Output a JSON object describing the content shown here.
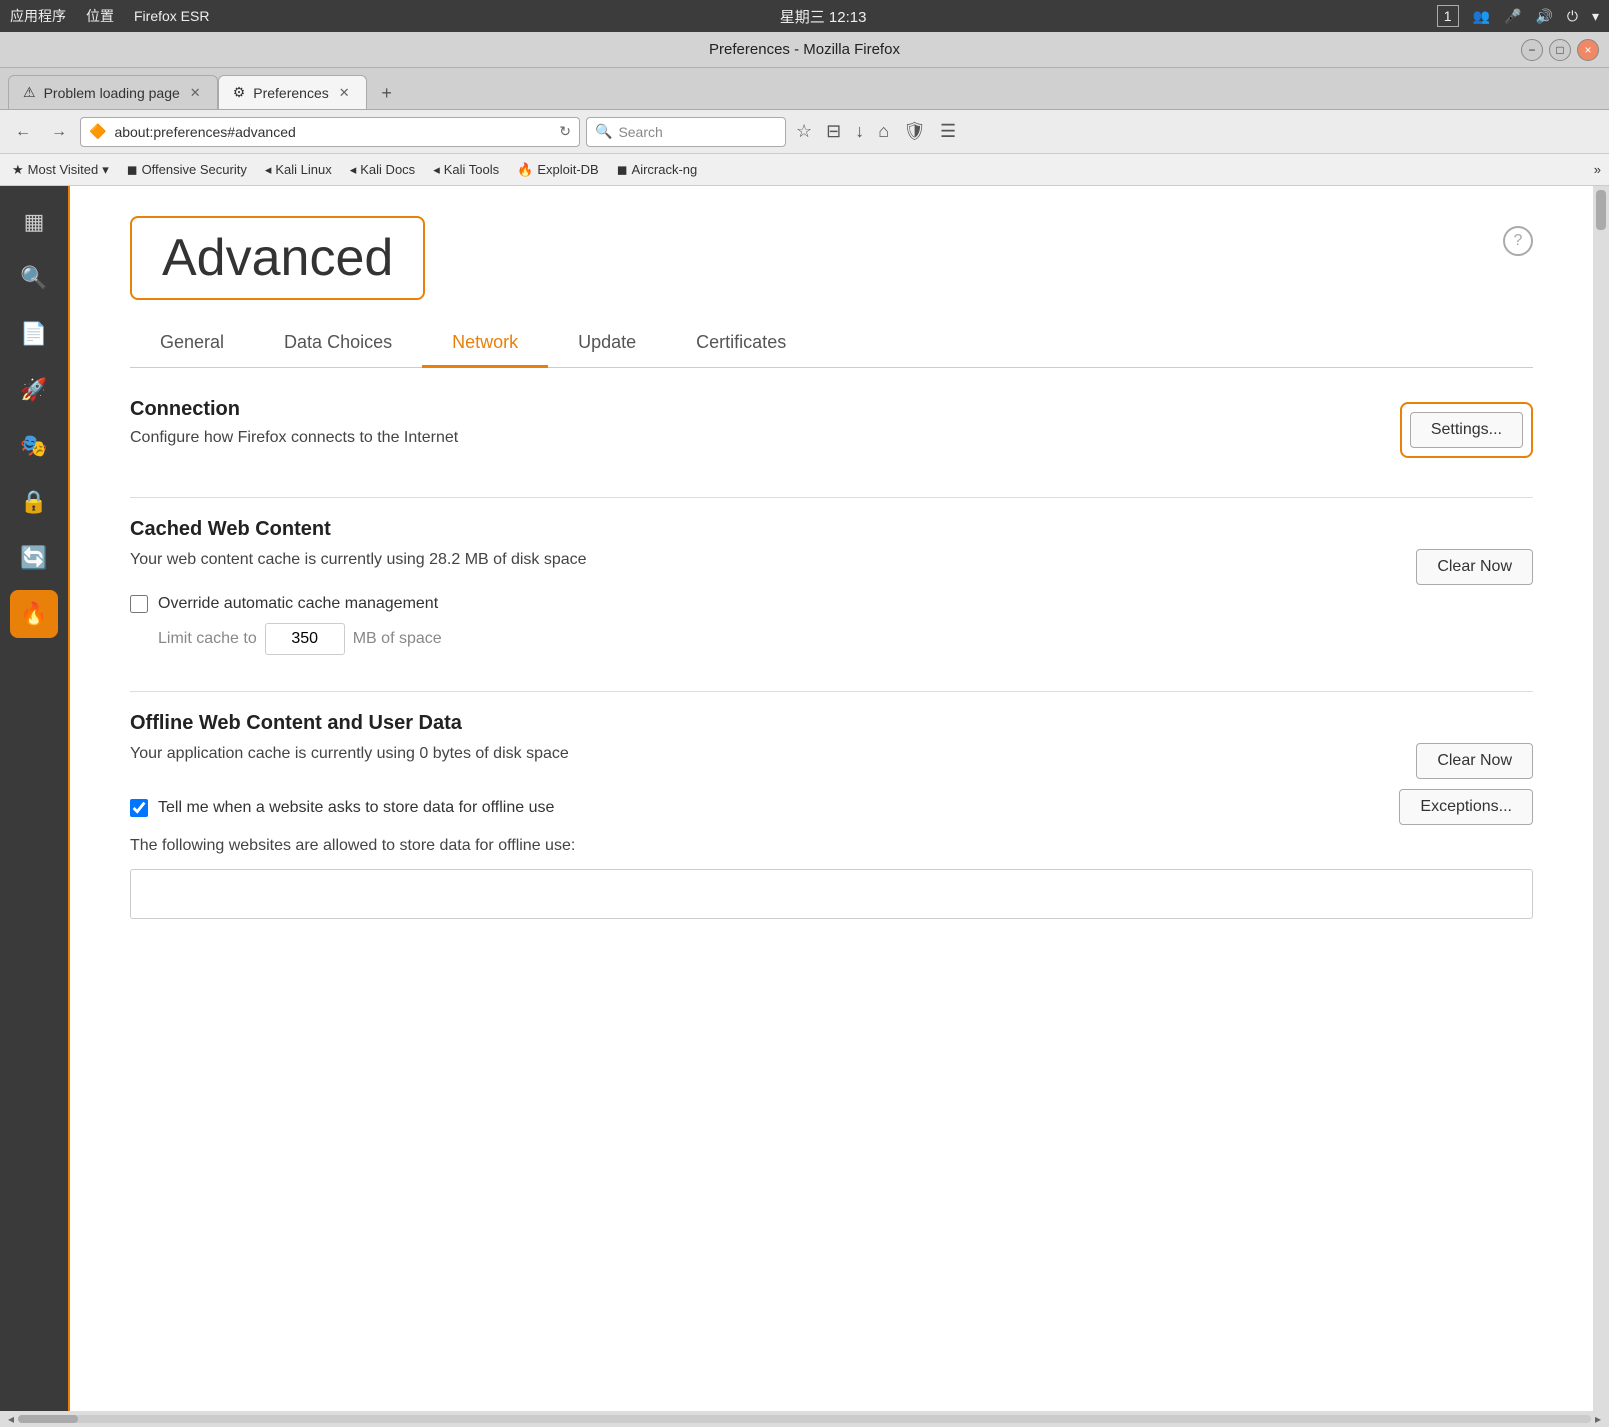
{
  "system_bar": {
    "apps_label": "应用程序",
    "location_label": "位置",
    "firefox_label": "Firefox ESR",
    "time": "星期三 12:13",
    "workspace_num": "1"
  },
  "title_bar": {
    "title": "Preferences - Mozilla Firefox",
    "minimize": "−",
    "maximize": "□",
    "close": "×"
  },
  "tabs": [
    {
      "label": "Problem loading page",
      "icon": "⚠",
      "active": false,
      "closeable": true
    },
    {
      "label": "Preferences",
      "icon": "⚙",
      "active": true,
      "closeable": true
    }
  ],
  "new_tab_label": "+",
  "address_bar": {
    "url": "about:preferences#advanced",
    "search_placeholder": "Search",
    "back_icon": "←",
    "forward_icon": "→",
    "reload_icon": "↻",
    "home_icon": "⌂",
    "bookmark_icon": "☆",
    "reader_icon": "≡",
    "download_icon": "↓",
    "shield_icon": "🛡",
    "menu_icon": "☰"
  },
  "bookmarks": [
    {
      "label": "Most Visited",
      "icon": "★"
    },
    {
      "label": "Offensive Security",
      "icon": "◼"
    },
    {
      "label": "Kali Linux",
      "icon": "◀"
    },
    {
      "label": "Kali Docs",
      "icon": "◀"
    },
    {
      "label": "Kali Tools",
      "icon": "◀"
    },
    {
      "label": "Exploit-DB",
      "icon": "🔥"
    },
    {
      "label": "Aircrack-ng",
      "icon": "◼"
    }
  ],
  "sidebar": {
    "items": [
      {
        "icon": "▦",
        "name": "grid",
        "active": false
      },
      {
        "icon": "🔍",
        "name": "search",
        "active": false
      },
      {
        "icon": "📄",
        "name": "document",
        "active": false
      },
      {
        "icon": "🚀",
        "name": "rocket",
        "active": false
      },
      {
        "icon": "🎭",
        "name": "mask",
        "active": false
      },
      {
        "icon": "🔒",
        "name": "lock",
        "active": false
      },
      {
        "icon": "🔄",
        "name": "refresh",
        "active": false
      },
      {
        "icon": "🔥",
        "name": "fire",
        "active": true
      }
    ]
  },
  "prefs": {
    "page_title": "Advanced",
    "help_icon": "?",
    "tabs": [
      {
        "label": "General",
        "active": false
      },
      {
        "label": "Data Choices",
        "active": false
      },
      {
        "label": "Network",
        "active": true
      },
      {
        "label": "Update",
        "active": false
      },
      {
        "label": "Certificates",
        "active": false
      }
    ],
    "connection": {
      "title": "Connection",
      "description": "Configure how Firefox connects to the Internet",
      "settings_button": "Settings..."
    },
    "cached_web_content": {
      "title": "Cached Web Content",
      "description": "Your web content cache is currently using 28.2 MB of disk space",
      "clear_now_label": "Clear Now",
      "override_label": "Override automatic cache management",
      "override_checked": false,
      "limit_label": "Limit cache to",
      "limit_value": "350",
      "limit_unit": "MB of space"
    },
    "offline_content": {
      "title": "Offline Web Content and User Data",
      "description": "Your application cache is currently using 0 bytes of disk space",
      "clear_now_label": "Clear Now",
      "tell_me_label": "Tell me when a website asks to store data for offline use",
      "tell_me_checked": true,
      "exceptions_label": "Exceptions...",
      "websites_label": "The following websites are allowed to store data for offline use:"
    }
  }
}
